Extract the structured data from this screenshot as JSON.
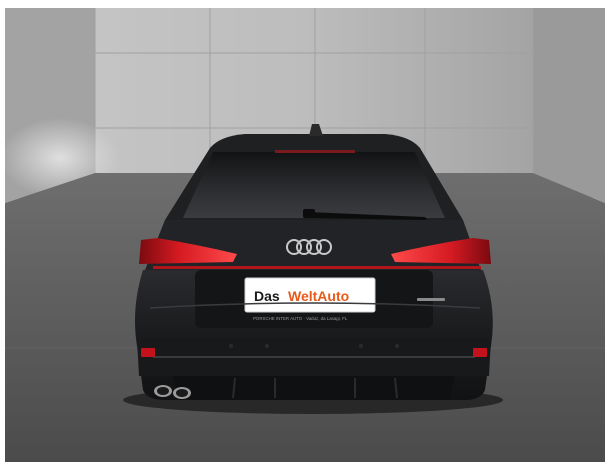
{
  "photo": {
    "plate": {
      "word1": "Das",
      "word2": "WeltAuto",
      "dealer_line": "PORSCHE INTER AUTO · Vaduz, da Lasagi, FL"
    },
    "colors": {
      "wall": "#b8b8b8",
      "floor": "#5a5a5a",
      "car_body": "#1b1c1e",
      "taillight": "#c3121b",
      "plate_accent": "#e85a1a"
    }
  }
}
